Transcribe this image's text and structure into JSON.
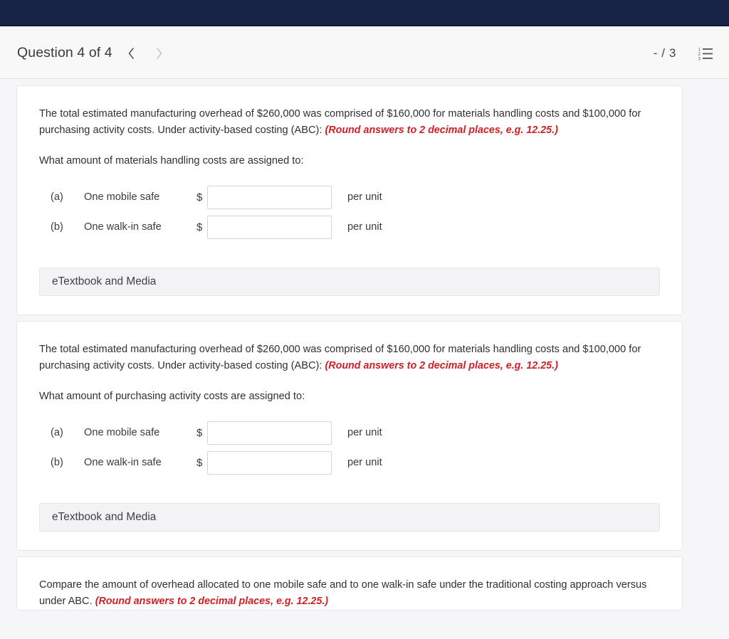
{
  "header": {
    "title": "Question 4 of 4",
    "prev_label": "chevron-left",
    "next_label": "chevron-right",
    "score": "- / 3",
    "list_icon": "numbered-list-icon"
  },
  "colors": {
    "navy": "#172347",
    "red_note": "#cf2026",
    "page_bg": "#f6f6f8",
    "card_bg": "#ffffff",
    "etext_bg": "#f3f3f5"
  },
  "cards": [
    {
      "prompt_part1": "The total estimated manufacturing overhead of $260,000 was comprised of $160,000 for materials handling costs and $100,000 for purchasing activity costs. Under activity-based costing (ABC):",
      "prompt_note": "(Round answers to 2 decimal places, e.g. 12.25.)",
      "sub_question": "What amount of materials handling costs are assigned to:",
      "rows": [
        {
          "letter": "(a)",
          "name": "One mobile safe",
          "currency": "$",
          "value": "",
          "placeholder": "",
          "suffix": "per unit"
        },
        {
          "letter": "(b)",
          "name": "One walk-in safe",
          "currency": "$",
          "value": "",
          "placeholder": "",
          "suffix": "per unit"
        }
      ],
      "etextbook_label": "eTextbook and Media"
    },
    {
      "prompt_part1": "The total estimated manufacturing overhead of $260,000 was comprised of $160,000 for materials handling costs and $100,000 for purchasing activity costs. Under activity-based costing (ABC):",
      "prompt_note": "(Round answers to 2 decimal places, e.g. 12.25.)",
      "sub_question": "What amount of purchasing activity costs are assigned to:",
      "rows": [
        {
          "letter": "(a)",
          "name": "One mobile safe",
          "currency": "$",
          "value": "",
          "placeholder": "",
          "suffix": "per unit"
        },
        {
          "letter": "(b)",
          "name": "One walk-in safe",
          "currency": "$",
          "value": "",
          "placeholder": "",
          "suffix": "per unit"
        }
      ],
      "etextbook_label": "eTextbook and Media"
    }
  ],
  "partial_card": {
    "prompt_part1": "Compare the amount of overhead allocated to one mobile safe and to one walk-in safe under the traditional costing approach versus under ABC.",
    "prompt_note": "(Round answers to 2 decimal places, e.g. 12.25.)"
  }
}
